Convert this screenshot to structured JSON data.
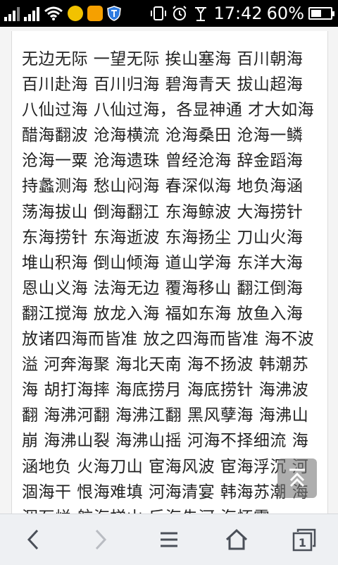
{
  "status_bar": {
    "time": "17:42",
    "battery": "60%",
    "battery_level": 0.6,
    "icons": [
      "signal-icon",
      "signal-icon",
      "wifi-icon",
      "app-notification-icon",
      "app-notification-icon",
      "shield-icon",
      "vibrate-icon",
      "alarm-icon",
      "sync-icon",
      "battery-icon"
    ]
  },
  "article": {
    "text": "无边无际 一望无际 挨山塞海 百川朝海 百川赴海 百川归海 碧海青天 拔山超海 八仙过海 八仙过海，各显神通 才大如海 醋海翻波 沧海横流 沧海桑田 沧海一鳞 沧海一粟 沧海遗珠 曾经沧海 辞金蹈海 持蠡测海 愁山闷海 春深似海 地负海涵 荡海拔山 倒海翻江 东海鲸波 大海捞针 东海捞针 东海逝波 东海扬尘 刀山火海 堆山积海 倒山倾海 道山学海 东洋大海 恩山义海 法海无边 覆海移山 翻江倒海 翻江搅海 放龙入海 福如东海 放鱼入海 放诸四海而皆准 放之四海而皆准 海不波溢 河奔海聚 海北天南 海不扬波 韩潮苏海 胡打海摔 海底捞月 海底捞针 海沸波翻 海沸河翻 海沸江翻 黑风孽海 海沸山崩 海沸山裂 海沸山摇 河海不择细流 海涵地负 火海刀山 宦海风波 宦海浮沉 河涸海干 恨海难填 河海清宴 韩海苏潮 海涸石烂 航海梯山 后海先河 海怀霞"
  },
  "to_top": {
    "label": "back to top"
  },
  "bottom_nav": {
    "back_label": "back",
    "forward_label": "forward",
    "menu_label": "menu",
    "home_label": "home",
    "tabs_count": "1"
  }
}
